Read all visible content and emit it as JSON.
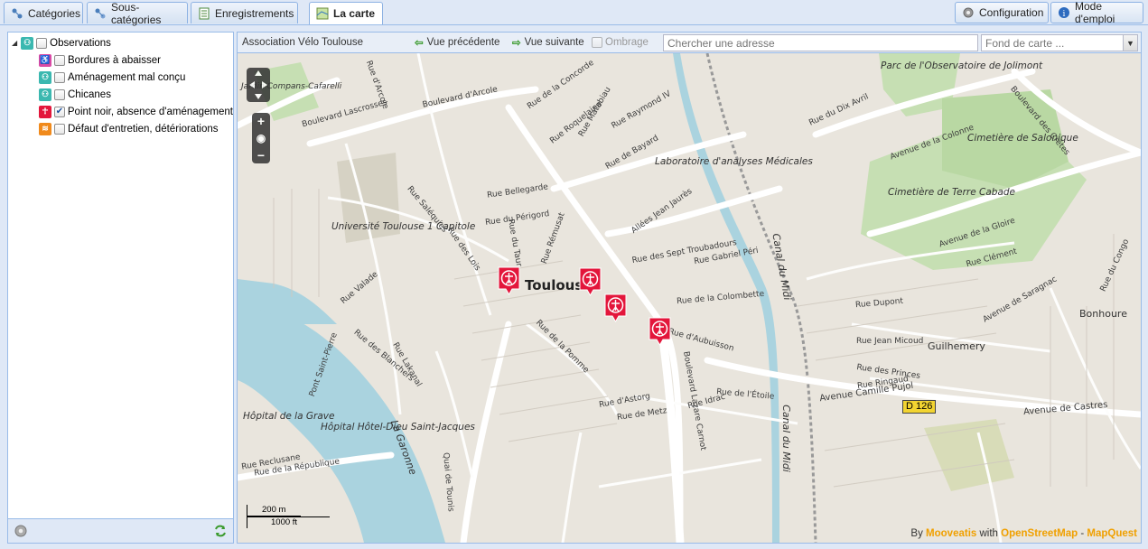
{
  "tabs": [
    {
      "label": "Catégories",
      "icon": "categories-icon"
    },
    {
      "label": "Sous-catégories",
      "icon": "subcategories-icon"
    },
    {
      "label": "Enregistrements",
      "icon": "records-icon"
    },
    {
      "label": "La carte",
      "icon": "map-icon",
      "active": true
    }
  ],
  "toolbar_right": {
    "config_label": "Configuration",
    "help_label": "Mode d'emploi"
  },
  "tree": {
    "root": {
      "label": "Observations",
      "checked": false
    },
    "children": [
      {
        "label": "Bordures à abaisser",
        "checked": false,
        "color": "#d94aa5"
      },
      {
        "label": "Aménagement mal conçu",
        "checked": false,
        "color": "#3bb8b0"
      },
      {
        "label": "Chicanes",
        "checked": false,
        "color": "#3bb8b0"
      },
      {
        "label": "Point noir, absence d'aménagement",
        "checked": true,
        "color": "#e3163b"
      },
      {
        "label": "Défaut d'entretien, détériorations",
        "checked": false,
        "color": "#f08a1c"
      }
    ]
  },
  "map_toolbar": {
    "title": "Association Vélo Toulouse",
    "prev_label": "Vue précédente",
    "next_label": "Vue suivante",
    "shade_label": "Ombrage",
    "address_placeholder": "Chercher une adresse",
    "basemap_placeholder": "Fond de carte ..."
  },
  "map": {
    "labels": {
      "boulevard_arcole": "Boulevard d'Arcole",
      "boulevard_lascrosses": "Boulevard Lascrosses",
      "rue_arcole": "Rue d'Arcole",
      "rue_concorde": "Rue de la Concorde",
      "rue_matabiau": "Rue Matabiau",
      "rue_bayard": "Rue de Bayard",
      "rue_raymond": "Rue Raymond IV",
      "rue_roquelaine": "Rue Roquelaine",
      "labo": "Laboratoire d'analyses Médicales",
      "canal_midi": "Canal du Midi",
      "canal_midi2": "Canal du Midi",
      "allees": "Allées Jean Jaurès",
      "rue_belegarde": "Rue Bellegarde",
      "rue_pergord": "Rue du Périgord",
      "rue_salenques": "Rue Saléquies",
      "rue_remusat": "Rue Rémusat",
      "univ": "Université Toulouse 1 Capitole",
      "toulouse": "Toulouse",
      "rue_lois": "Rue des Lois",
      "rue_pomme": "Rue de la Pomme",
      "rue_taur": "Rue du Taur",
      "rue_valade": "Rue Valade",
      "rue_blanchers": "Rue des Blanchers",
      "rue_lakanal": "Rue Lakanal",
      "pont_st_pierre": "Pont Saint-Pierre",
      "garonne": "La Garonne",
      "hopital_grave": "Hôpital de la Grave",
      "hotel_dieu": "Hôpital Hôtel-Dieu Saint-Jacques",
      "rue_republique": "Rue de la République",
      "rue_reclusane": "Rue Reclusane",
      "quai_tounis": "Quai de Tounis",
      "rue_metz": "Rue de Metz",
      "rue_astorg": "Rue d'Astorg",
      "rue_aubuisson": "Rue d'Aubuisson",
      "rue_colombette": "Rue de la Colombette",
      "rue_sept_troubadours": "Rue des Sept Troubadours",
      "rue_gabriel_peri": "Rue Gabriel Péri",
      "boulevard_lazare": "Boulevard Lazare Carnot",
      "rue_etoile": "Rue de l'Étoile",
      "rue_idrac": "Rue Idrac",
      "rue_ringaud": "Rue Ringaud",
      "rue_princes": "Rue des Princes",
      "avenue_camille": "Avenue Camille Pujol",
      "avenue_castres": "Avenue de Castres",
      "rue_jean_micoud": "Rue Jean Micoud",
      "guilhemery": "Guilhemery",
      "bonhoure": "Bonhoure",
      "avenue_gloire": "Avenue de la Gloire",
      "avenue_colonne": "Avenue de la Colonne",
      "rue_dix_avril": "Rue du Dix Avril",
      "parc_observatoire": "Parc de l'Observatoire de Jolimont",
      "cim_salonique": "Cimetière de Salonique",
      "cim_terre_cabade": "Cimetière de Terre Cabade",
      "boulevard_cretes": "Boulevard des Crêtes",
      "rue_clement": "Rue Clément",
      "avenue_saragnac": "Avenue de Saragnac",
      "rue_congo": "Rue du Congo",
      "rue_dupont": "Rue Dupont",
      "jardin_cafarelli": "Jardin Compans-Cafarelli",
      "road_badge": "D 126"
    },
    "scale_m": "200 m",
    "scale_ft": "1000 ft",
    "attrib_by": "By",
    "attrib_mooveatis": "Mooveatis",
    "attrib_with": "with",
    "attrib_osm": "OpenStreetMap",
    "attrib_dash": "-",
    "attrib_mapquest": "MapQuest"
  }
}
